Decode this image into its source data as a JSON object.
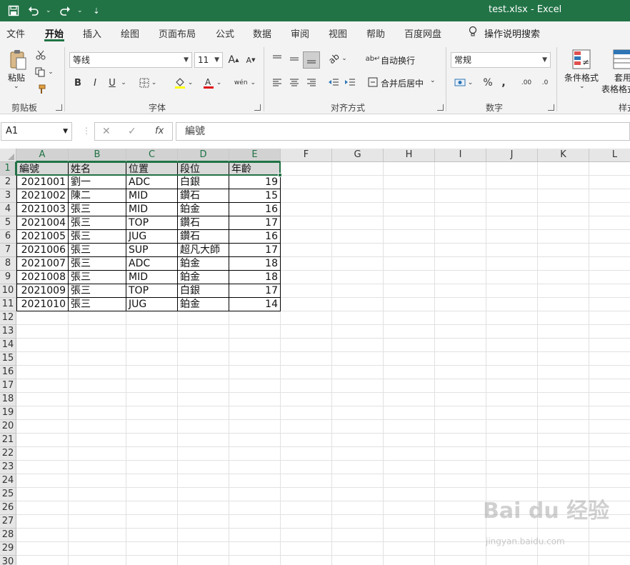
{
  "window": {
    "title": "test.xlsx  -  Excel"
  },
  "tabs": [
    "文件",
    "开始",
    "插入",
    "绘图",
    "页面布局",
    "公式",
    "数据",
    "审阅",
    "视图",
    "帮助",
    "百度网盘"
  ],
  "active_tab": "开始",
  "tell_me": "操作说明搜索",
  "ribbon": {
    "clipboard": {
      "paste": "粘贴",
      "label": "剪贴板"
    },
    "font": {
      "name": "等线",
      "size": "11",
      "label": "字体",
      "bold": "B",
      "italic": "I",
      "underline": "U",
      "grow": "A",
      "shrink": "A",
      "phonetic": "wén"
    },
    "alignment": {
      "wrap": "自动换行",
      "merge": "合并后居中",
      "label": "对齐方式"
    },
    "number": {
      "format": "常规",
      "percent": "%",
      "comma": ",",
      "label": "数字",
      "inc": ".00",
      "dec": ".0"
    },
    "styles": {
      "conditional": "条件格式",
      "table1": "套用",
      "table2": "表格格式",
      "label": "样式"
    }
  },
  "formula_bar": {
    "name_box": "A1",
    "fx": "fx",
    "formula": "編號"
  },
  "columns": [
    "A",
    "B",
    "C",
    "D",
    "E",
    "F",
    "G",
    "H",
    "I",
    "J",
    "K",
    "L"
  ],
  "rows": [
    "1",
    "2",
    "3",
    "4",
    "5",
    "6",
    "7",
    "8",
    "9",
    "10",
    "11",
    "12",
    "13",
    "14",
    "15",
    "16",
    "17",
    "18",
    "19",
    "20",
    "21",
    "22",
    "23",
    "24",
    "25",
    "26",
    "27",
    "28",
    "29",
    "30"
  ],
  "table": {
    "headers": [
      "編號",
      "姓名",
      "位置",
      "段位",
      "年齡"
    ],
    "rows": [
      [
        "2021001",
        "劉一",
        "ADC",
        "白銀",
        "19"
      ],
      [
        "2021002",
        "陳二",
        "MID",
        "鑽石",
        "15"
      ],
      [
        "2021003",
        "張三",
        "MID",
        "鉑金",
        "16"
      ],
      [
        "2021004",
        "張三",
        "TOP",
        "鑽石",
        "17"
      ],
      [
        "2021005",
        "張三",
        "JUG",
        "鑽石",
        "16"
      ],
      [
        "2021006",
        "張三",
        "SUP",
        "超凡大師",
        "17"
      ],
      [
        "2021007",
        "張三",
        "ADC",
        "鉑金",
        "18"
      ],
      [
        "2021008",
        "張三",
        "MID",
        "鉑金",
        "18"
      ],
      [
        "2021009",
        "張三",
        "TOP",
        "白銀",
        "17"
      ],
      [
        "2021010",
        "張三",
        "JUG",
        "鉑金",
        "14"
      ]
    ]
  },
  "watermark": {
    "brand": "Bai du 经验",
    "url": "jingyan.baidu.com"
  }
}
